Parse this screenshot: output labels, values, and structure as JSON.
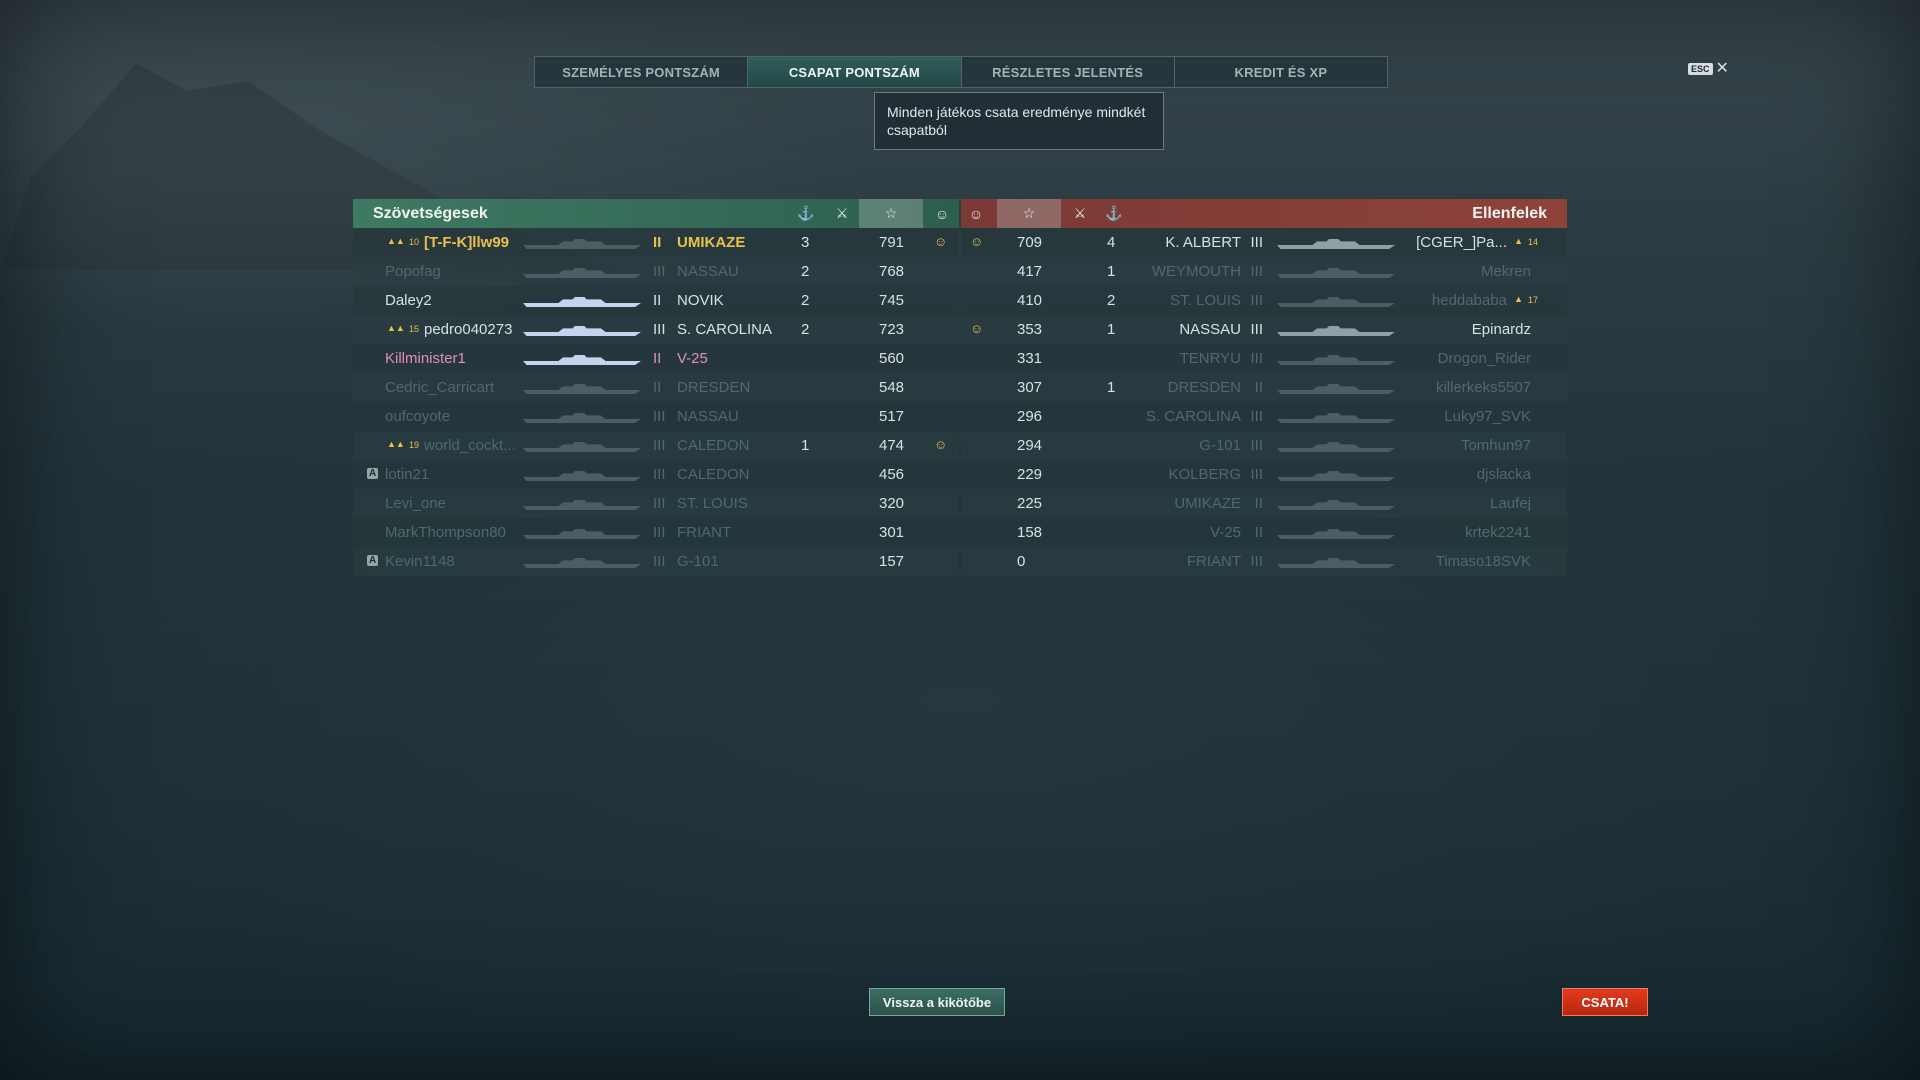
{
  "tabs": [
    "SZEMÉLYES PONTSZÁM",
    "CSAPAT PONTSZÁM",
    "RÉSZLETES JELENTÉS",
    "KREDIT ÉS XP"
  ],
  "esc_label": "ESC",
  "tooltip": "Minden játékos csata eredménye mindkét csapatból",
  "allies": {
    "title": "Szövetségesek",
    "rows": [
      {
        "rank": "10",
        "name": "[T-F-K]llw99",
        "tier": "II",
        "ship": "UMIKAZE",
        "kills": "3",
        "score": "791",
        "medal": "☺",
        "style": "gold",
        "clan": true,
        "bot": false
      },
      {
        "rank": "",
        "name": "Popofag",
        "tier": "III",
        "ship": "NASSAU",
        "kills": "2",
        "score": "768",
        "medal": "",
        "style": "dim",
        "clan": false,
        "bot": false
      },
      {
        "rank": "",
        "name": "Daley2",
        "tier": "II",
        "ship": "NOVIK",
        "kills": "2",
        "score": "745",
        "medal": "",
        "style": "",
        "clan": false,
        "bot": false
      },
      {
        "rank": "15",
        "name": "pedro040273",
        "tier": "III",
        "ship": "S. CAROLINA",
        "kills": "2",
        "score": "723",
        "medal": "",
        "style": "",
        "clan": true,
        "bot": false
      },
      {
        "rank": "",
        "name": "Killminister1",
        "tier": "II",
        "ship": "V-25",
        "kills": "",
        "score": "560",
        "medal": "",
        "style": "pink",
        "clan": false,
        "bot": false
      },
      {
        "rank": "",
        "name": "Cedric_Carricart",
        "tier": "II",
        "ship": "DRESDEN",
        "kills": "",
        "score": "548",
        "medal": "",
        "style": "dim",
        "clan": false,
        "bot": false
      },
      {
        "rank": "",
        "name": "oufcoyote",
        "tier": "III",
        "ship": "NASSAU",
        "kills": "",
        "score": "517",
        "medal": "",
        "style": "dim",
        "clan": false,
        "bot": false
      },
      {
        "rank": "19",
        "name": "world_cockt...",
        "tier": "III",
        "ship": "CALEDON",
        "kills": "1",
        "score": "474",
        "medal": "☺",
        "style": "dim",
        "clan": true,
        "bot": false
      },
      {
        "rank": "",
        "name": "lotin21",
        "tier": "III",
        "ship": "CALEDON",
        "kills": "",
        "score": "456",
        "medal": "",
        "style": "dim",
        "clan": false,
        "bot": true
      },
      {
        "rank": "",
        "name": "Levi_one",
        "tier": "III",
        "ship": "ST. LOUIS",
        "kills": "",
        "score": "320",
        "medal": "",
        "style": "dim",
        "clan": false,
        "bot": false
      },
      {
        "rank": "",
        "name": "MarkThompson80",
        "tier": "III",
        "ship": "FRIANT",
        "kills": "",
        "score": "301",
        "medal": "",
        "style": "dim",
        "clan": false,
        "bot": false
      },
      {
        "rank": "",
        "name": "Kevin1148",
        "tier": "III",
        "ship": "G-101",
        "kills": "",
        "score": "157",
        "medal": "",
        "style": "dim",
        "clan": false,
        "bot": true
      }
    ]
  },
  "enemies": {
    "title": "Ellenfelek",
    "rows": [
      {
        "rank": "14",
        "name": "[CGER_]Pa...",
        "tier": "III",
        "ship": "K. ALBERT",
        "kills": "4",
        "score": "709",
        "medal": "☺",
        "style": "",
        "clan": true
      },
      {
        "rank": "",
        "name": "Mekren",
        "tier": "III",
        "ship": "WEYMOUTH",
        "kills": "1",
        "score": "417",
        "medal": "",
        "style": "dim",
        "clan": false
      },
      {
        "rank": "17",
        "name": "heddababa",
        "tier": "III",
        "ship": "ST. LOUIS",
        "kills": "2",
        "score": "410",
        "medal": "",
        "style": "dim",
        "clan": true
      },
      {
        "rank": "",
        "name": "Epinardz",
        "tier": "III",
        "ship": "NASSAU",
        "kills": "1",
        "score": "353",
        "medal": "☺",
        "style": "",
        "clan": false
      },
      {
        "rank": "",
        "name": "Drogon_Rider",
        "tier": "III",
        "ship": "TENRYU",
        "kills": "",
        "score": "331",
        "medal": "",
        "style": "dim",
        "clan": false
      },
      {
        "rank": "",
        "name": "killerkeks5507",
        "tier": "II",
        "ship": "DRESDEN",
        "kills": "1",
        "score": "307",
        "medal": "",
        "style": "dim",
        "clan": false
      },
      {
        "rank": "",
        "name": "Luky97_SVK",
        "tier": "III",
        "ship": "S. CAROLINA",
        "kills": "",
        "score": "296",
        "medal": "",
        "style": "dim",
        "clan": false
      },
      {
        "rank": "",
        "name": "Tomhun97",
        "tier": "III",
        "ship": "G-101",
        "kills": "",
        "score": "294",
        "medal": "",
        "style": "dim",
        "clan": false
      },
      {
        "rank": "",
        "name": "djslacka",
        "tier": "III",
        "ship": "KOLBERG",
        "kills": "",
        "score": "229",
        "medal": "",
        "style": "dim",
        "clan": false
      },
      {
        "rank": "",
        "name": "Laufej",
        "tier": "II",
        "ship": "UMIKAZE",
        "kills": "",
        "score": "225",
        "medal": "",
        "style": "dim",
        "clan": false
      },
      {
        "rank": "",
        "name": "krtek2241",
        "tier": "II",
        "ship": "V-25",
        "kills": "",
        "score": "158",
        "medal": "",
        "style": "dim",
        "clan": false
      },
      {
        "rank": "",
        "name": "Timaso18SVK",
        "tier": "III",
        "ship": "FRIANT",
        "kills": "",
        "score": "0",
        "medal": "",
        "style": "dim",
        "clan": false
      }
    ]
  },
  "buttons": {
    "back_to_port": "Vissza a kikötőbe",
    "battle": "CSATA!"
  },
  "colors": {
    "allies_header": "#3e7a62",
    "enemies_header": "#8e4239",
    "gold": "#e8c04a",
    "battle_button": "#d2331a"
  },
  "icons": {
    "ribbon": "ribbon-icon",
    "kills": "crossed-swords-icon",
    "score": "star-icon",
    "medal": "medal-icon",
    "clan": "clan-icon",
    "bot": "bot-icon"
  }
}
